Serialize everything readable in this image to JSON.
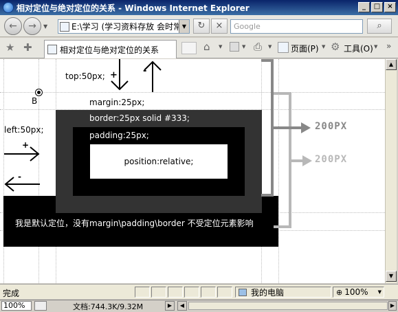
{
  "window": {
    "title": "相对定位与绝对定位的关系 - Windows Internet Explorer",
    "min_glyph": "_",
    "max_glyph": "□",
    "close_glyph": "×"
  },
  "address_bar": {
    "back_glyph": "←",
    "forward_glyph": "→",
    "url": "E:\\学习 (学习资料存放 会时常",
    "refresh_glyph": "↻",
    "stop_glyph": "×",
    "search_placeholder": "Google",
    "search_glyph": "⌕"
  },
  "command_bar": {
    "tab_title": "相对定位与绝对定位的关系",
    "page_menu": "页面(P)",
    "tools_menu": "工具(O)"
  },
  "content": {
    "top_label": "top:50px;",
    "minus_label": "-",
    "plus_label": "+",
    "point_label": "B",
    "left_label": "left:50px;",
    "margin_label": "margin:25px;",
    "border_label": "border:25px solid #333;",
    "padding_label": "padding:25px;",
    "inner_label": "position:relative;",
    "default_label": "我是默认定位，没有margin\\padding\\border 不受定位元素影响",
    "dim_label_1": "200PX",
    "dim_label_2": "200PX"
  },
  "status_bar": {
    "status_text": "完成",
    "zone_text": "我的电脑",
    "zoom_text": "100%"
  },
  "bottom_bar": {
    "zoom_text": "100%",
    "doc_size": "文档:744.3K/9.32M"
  },
  "colors": {
    "dark_border": "#333333",
    "black": "#000000",
    "bracket_dark": "#888888",
    "bracket_light": "#b8b8b8"
  }
}
